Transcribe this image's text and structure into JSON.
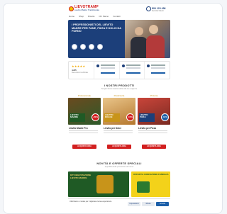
{
  "header": {
    "logo_text": "LIEVOTRAMP",
    "logo_sub": "Lievito Madre Tradizionale",
    "phone": "800 123 456",
    "phone_sub": "Servizio Clienti"
  },
  "nav": [
    "Home",
    "Shop",
    "Ricette",
    "Chi Siamo",
    "Contatti"
  ],
  "hero": {
    "title": "I PROFESSIONISTI DEL LIEVITO MADRE PER PANE, PIZZA E DOLCI DA FORNO"
  },
  "trust": {
    "stars": "★★★★★",
    "rating_label": "4.8/5",
    "rating_sub": "Recensioni verificate"
  },
  "section_products": {
    "title": "I NOSTRI PRODOTTI",
    "subtitle": "Scegli il lievito madre adatto alle tue esigenze"
  },
  "products": [
    {
      "head": "Professionale",
      "banner": "LIEVITO MADRE",
      "discount": "-20%",
      "name": "Lievito Madre Pro",
      "button": "ACQUISTA ORA",
      "color": "#1f5a25"
    },
    {
      "head": "Pasticceria",
      "banner": "LIEVITO DOLCE",
      "discount": "-15%",
      "name": "Lievito per Dolci",
      "button": "ACQUISTA ORA",
      "color": "#c8941a"
    },
    {
      "head": "Pizzeria",
      "banner": "LIEVITO PIZZA",
      "discount": "-10%",
      "name": "Lievito per Pizza",
      "button": "ACQUISTA ORA",
      "color": "#1c3f7a"
    }
  ],
  "section_promos": {
    "title": "NOVITÀ E OFFERTE SPECIALI",
    "subtitle": "Approfitta delle promozioni del mese"
  },
  "promos": {
    "left_text": "KIT DEGUSTAZIONE LIEVITO MADRE",
    "right_text": "OFFERTA CONFEZIONE FAMIGLIA"
  },
  "cookie": {
    "text": "Utilizziamo i cookie per migliorare la tua esperienza.",
    "accept": "Accetta",
    "settings": "Impostazioni",
    "reject": "Rifiuta"
  }
}
